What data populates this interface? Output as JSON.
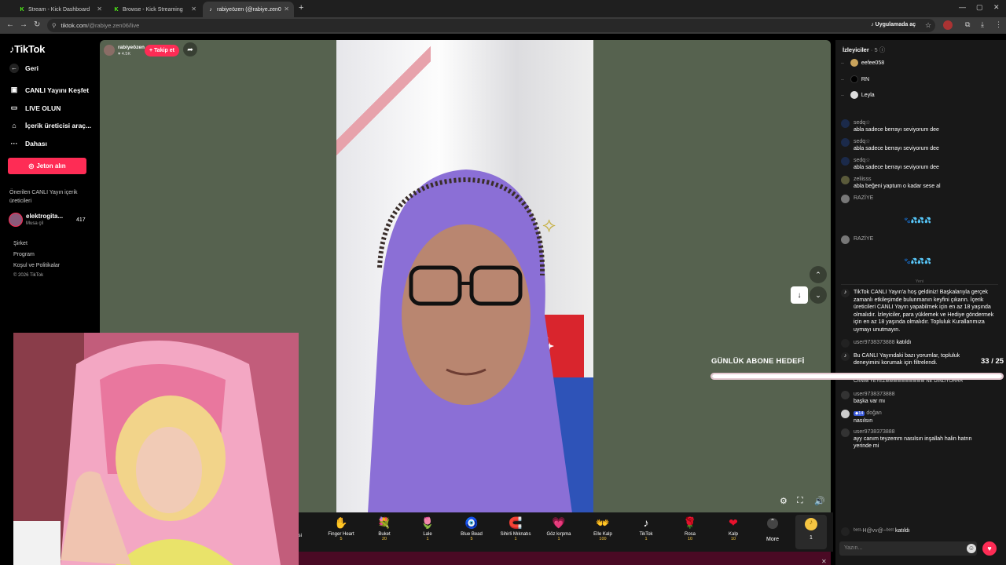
{
  "browser": {
    "tabs": [
      {
        "title": "Stream - Kick Dashboard",
        "favicon": "kick-icon",
        "active": false
      },
      {
        "title": "Browse - Kick Streaming",
        "favicon": "kick-icon",
        "active": false
      },
      {
        "title": "rabiyeözen (@rabiye.zen0",
        "favicon": "tiktok-icon",
        "active": true
      }
    ],
    "url_host": "tiktok.com",
    "url_path": "/@rabiye.zen06/live",
    "open_in_app": "Uygulamada aç"
  },
  "sidebar": {
    "logo": "TikTok",
    "back": "Geri",
    "items": [
      {
        "label": "CANLI Yayını Keşfet",
        "icon": "live-explore-icon"
      },
      {
        "label": "LIVE OLUN",
        "icon": "camera-icon"
      },
      {
        "label": "İçerik üreticisi araç...",
        "icon": "home-tools-icon"
      },
      {
        "label": "Dahası",
        "icon": "more-dots-icon"
      }
    ],
    "coin_button": "Jeton alın",
    "recommended_title": "Önerilen CANLI Yayın içerik üreticileri",
    "recommended": [
      {
        "name": "elektrogita...",
        "sub": "Musa çil",
        "count": "417"
      }
    ],
    "footer_links": [
      "Şirket",
      "Program",
      "Koşul ve Politikalar"
    ],
    "copyright": "© 2026 TikTok"
  },
  "stream": {
    "host_name": "rabiyeözen",
    "host_likes": "4.5K",
    "follow_label": "+ Takip et"
  },
  "gifts": {
    "items": [
      {
        "name": "Finger Heart",
        "price": "5",
        "glyph": "✋"
      },
      {
        "name": "Buket",
        "price": "20",
        "glyph": "💐"
      },
      {
        "name": "Lale",
        "price": "1",
        "glyph": "🌷"
      },
      {
        "name": "Blue Bead",
        "price": "5",
        "glyph": "🧿"
      },
      {
        "name": "Sihirli Mıknatıs",
        "price": "1",
        "glyph": "🧲"
      },
      {
        "name": "Göz kırpma",
        "price": "1",
        "glyph": "💗"
      },
      {
        "name": "Elle Kalp",
        "price": "100",
        "glyph": "👐"
      },
      {
        "name": "TikTok",
        "price": "1",
        "glyph": "♪"
      },
      {
        "name": "Rosa",
        "price": "10",
        "glyph": "🌹"
      },
      {
        "name": "Kalp",
        "price": "10",
        "glyph": "❤"
      }
    ],
    "partial_label": "ivesi",
    "more_label": "More",
    "coin_count": "1"
  },
  "panel": {
    "viewers_title": "İzleyiciler",
    "viewers_count": "5",
    "viewers": [
      "eefee058",
      "RN",
      "Leyla"
    ],
    "comments": [
      {
        "user": "sedq☆",
        "text": "abla sadece berrayı seviyorum dee"
      },
      {
        "user": "sedq☆",
        "text": "abla sadece berrayı seviyorum dee"
      },
      {
        "user": "sedq☆",
        "text": "abla sadece berrayı seviyorum dee"
      },
      {
        "user": "zeliisss",
        "text": "abla beğeni yaptum o kadar sese al"
      },
      {
        "user": "RAZİYE",
        "text": "🐾💦💦💦"
      },
      {
        "user": "RAZİYE",
        "text": "🐾💦💦💦"
      }
    ],
    "separator": "Yeni",
    "welcome": "TikTok CANLI Yayın'a hoş geldiniz! Başkalarıyla gerçek zamanlı etkileşimde bulunmanın keyfini çıkarın. İçerik üreticileri CANLI Yayın yapabilmek için en az 18 yaşında olmalıdır. İzleyiciler, para yüklemek ve Hediye göndermek için en az 18 yaşında olmalıdır. Topluluk Kurallarımıza uymayı unutmayın.",
    "joined1_user": "user9738373888",
    "joined_label": "katıldı",
    "filter_notice": "Bu CANLI Yayındaki bazı yorumlar, topluluk deneyimini korumak için filtrelendi.",
    "cut_text": "CANIM YEYEZMMMMMMMMMM NE DİNLİYORRR",
    "comments2": [
      {
        "user": "user9738373888",
        "text": "başka var mı"
      },
      {
        "user": "doğan",
        "text": "nasılsın",
        "badge": "14"
      },
      {
        "user": "user9738373888",
        "text": "ayy canım teyzemm nasılsın inşallah halin hatrın yerinde mi"
      }
    ],
    "joined2_user": "ᵇᵉˢᵗ-H@vv@~ᵇᵉˢᵗ",
    "input_placeholder": "Yazın..."
  },
  "goal": {
    "title": "GÜNLÜK ABONE HEDEFİ",
    "count": "33 / 25",
    "progress": 1.0
  }
}
